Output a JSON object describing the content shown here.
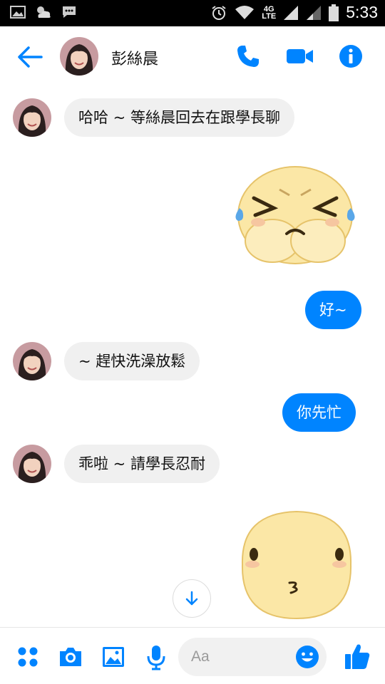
{
  "status_bar": {
    "time": "5:33",
    "network": "4G",
    "network_sub": "LTE"
  },
  "header": {
    "contact_name": "彭絲晨"
  },
  "messages": [
    {
      "direction": "in",
      "text": "哈哈 ~ 等絲晨回去在跟學長聊"
    },
    {
      "direction": "out",
      "sticker": "crying-face-sticker"
    },
    {
      "direction": "out",
      "text": "好~"
    },
    {
      "direction": "in",
      "text": "~ 趕快洗澡放鬆"
    },
    {
      "direction": "out",
      "text": "你先忙"
    },
    {
      "direction": "in",
      "text": "乖啦 ~ 請學長忍耐"
    },
    {
      "direction": "out",
      "sticker": "kissing-face-sticker"
    }
  ],
  "composer": {
    "placeholder": "Aa"
  },
  "colors": {
    "accent": "#0084ff",
    "incoming_bubble": "#f0f0f0",
    "sticker_face": "#fbe7a6"
  }
}
